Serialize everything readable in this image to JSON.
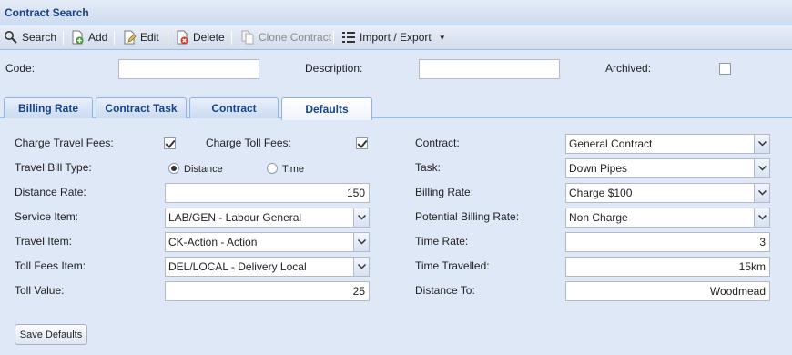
{
  "window": {
    "title": "Contract Search"
  },
  "toolbar": {
    "search": "Search",
    "add": "Add",
    "edit": "Edit",
    "delete": "Delete",
    "clone": "Clone Contract",
    "import_export": "Import / Export"
  },
  "filters": {
    "code_label": "Code:",
    "code_value": "",
    "description_label": "Description:",
    "description_value": "",
    "archived_label": "Archived:",
    "archived_checked": false
  },
  "tabs": [
    {
      "label": "Billing Rate",
      "active": false
    },
    {
      "label": "Contract Task",
      "active": false
    },
    {
      "label": "Contract",
      "active": false
    },
    {
      "label": "Defaults",
      "active": true
    }
  ],
  "defaults": {
    "charge_travel_fees_label": "Charge Travel Fees:",
    "charge_travel_fees_checked": true,
    "charge_toll_fees_label": "Charge Toll Fees:",
    "charge_toll_fees_checked": true,
    "travel_bill_type_label": "Travel Bill Type:",
    "travel_bill_type_options": [
      "Distance",
      "Time"
    ],
    "travel_bill_type_selected": "Distance",
    "distance_rate_label": "Distance Rate:",
    "distance_rate_value": "150",
    "service_item_label": "Service Item:",
    "service_item_value": "LAB/GEN - Labour General",
    "travel_item_label": "Travel Item:",
    "travel_item_value": "CK-Action - Action",
    "toll_fees_item_label": "Toll Fees Item:",
    "toll_fees_item_value": "DEL/LOCAL - Delivery Local",
    "toll_value_label": "Toll Value:",
    "toll_value_value": "25",
    "contract_label": "Contract:",
    "contract_value": "General Contract",
    "task_label": "Task:",
    "task_value": "Down Pipes",
    "billing_rate_label": "Billing Rate:",
    "billing_rate_value": "Charge $100",
    "potential_billing_rate_label": "Potential Billing Rate:",
    "potential_billing_rate_value": "Non Charge",
    "time_rate_label": "Time Rate:",
    "time_rate_value": "3",
    "time_travelled_label": "Time Travelled:",
    "time_travelled_value": "15km",
    "distance_to_label": "Distance To:",
    "distance_to_value": "Woodmead",
    "save_button": "Save Defaults"
  }
}
